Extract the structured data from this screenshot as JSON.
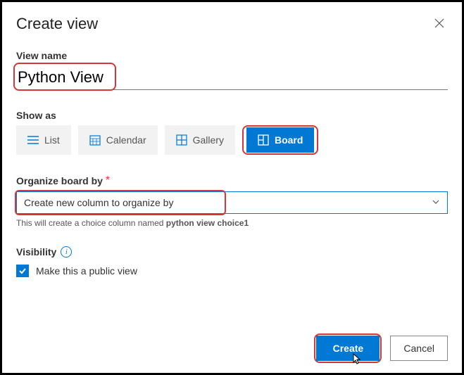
{
  "header": {
    "title": "Create view"
  },
  "view_name": {
    "label": "View name",
    "value": "Python View"
  },
  "show_as": {
    "label": "Show as",
    "options": {
      "list": "List",
      "calendar": "Calendar",
      "gallery": "Gallery",
      "board": "Board"
    }
  },
  "organize": {
    "label": "Organize board by",
    "required": "*",
    "selected": "Create new column to organize by",
    "helper_prefix": "This will create a choice column named ",
    "helper_bold": "python view choice1"
  },
  "visibility": {
    "label": "Visibility",
    "checkbox_label": "Make this a public view"
  },
  "footer": {
    "create": "Create",
    "cancel": "Cancel"
  }
}
